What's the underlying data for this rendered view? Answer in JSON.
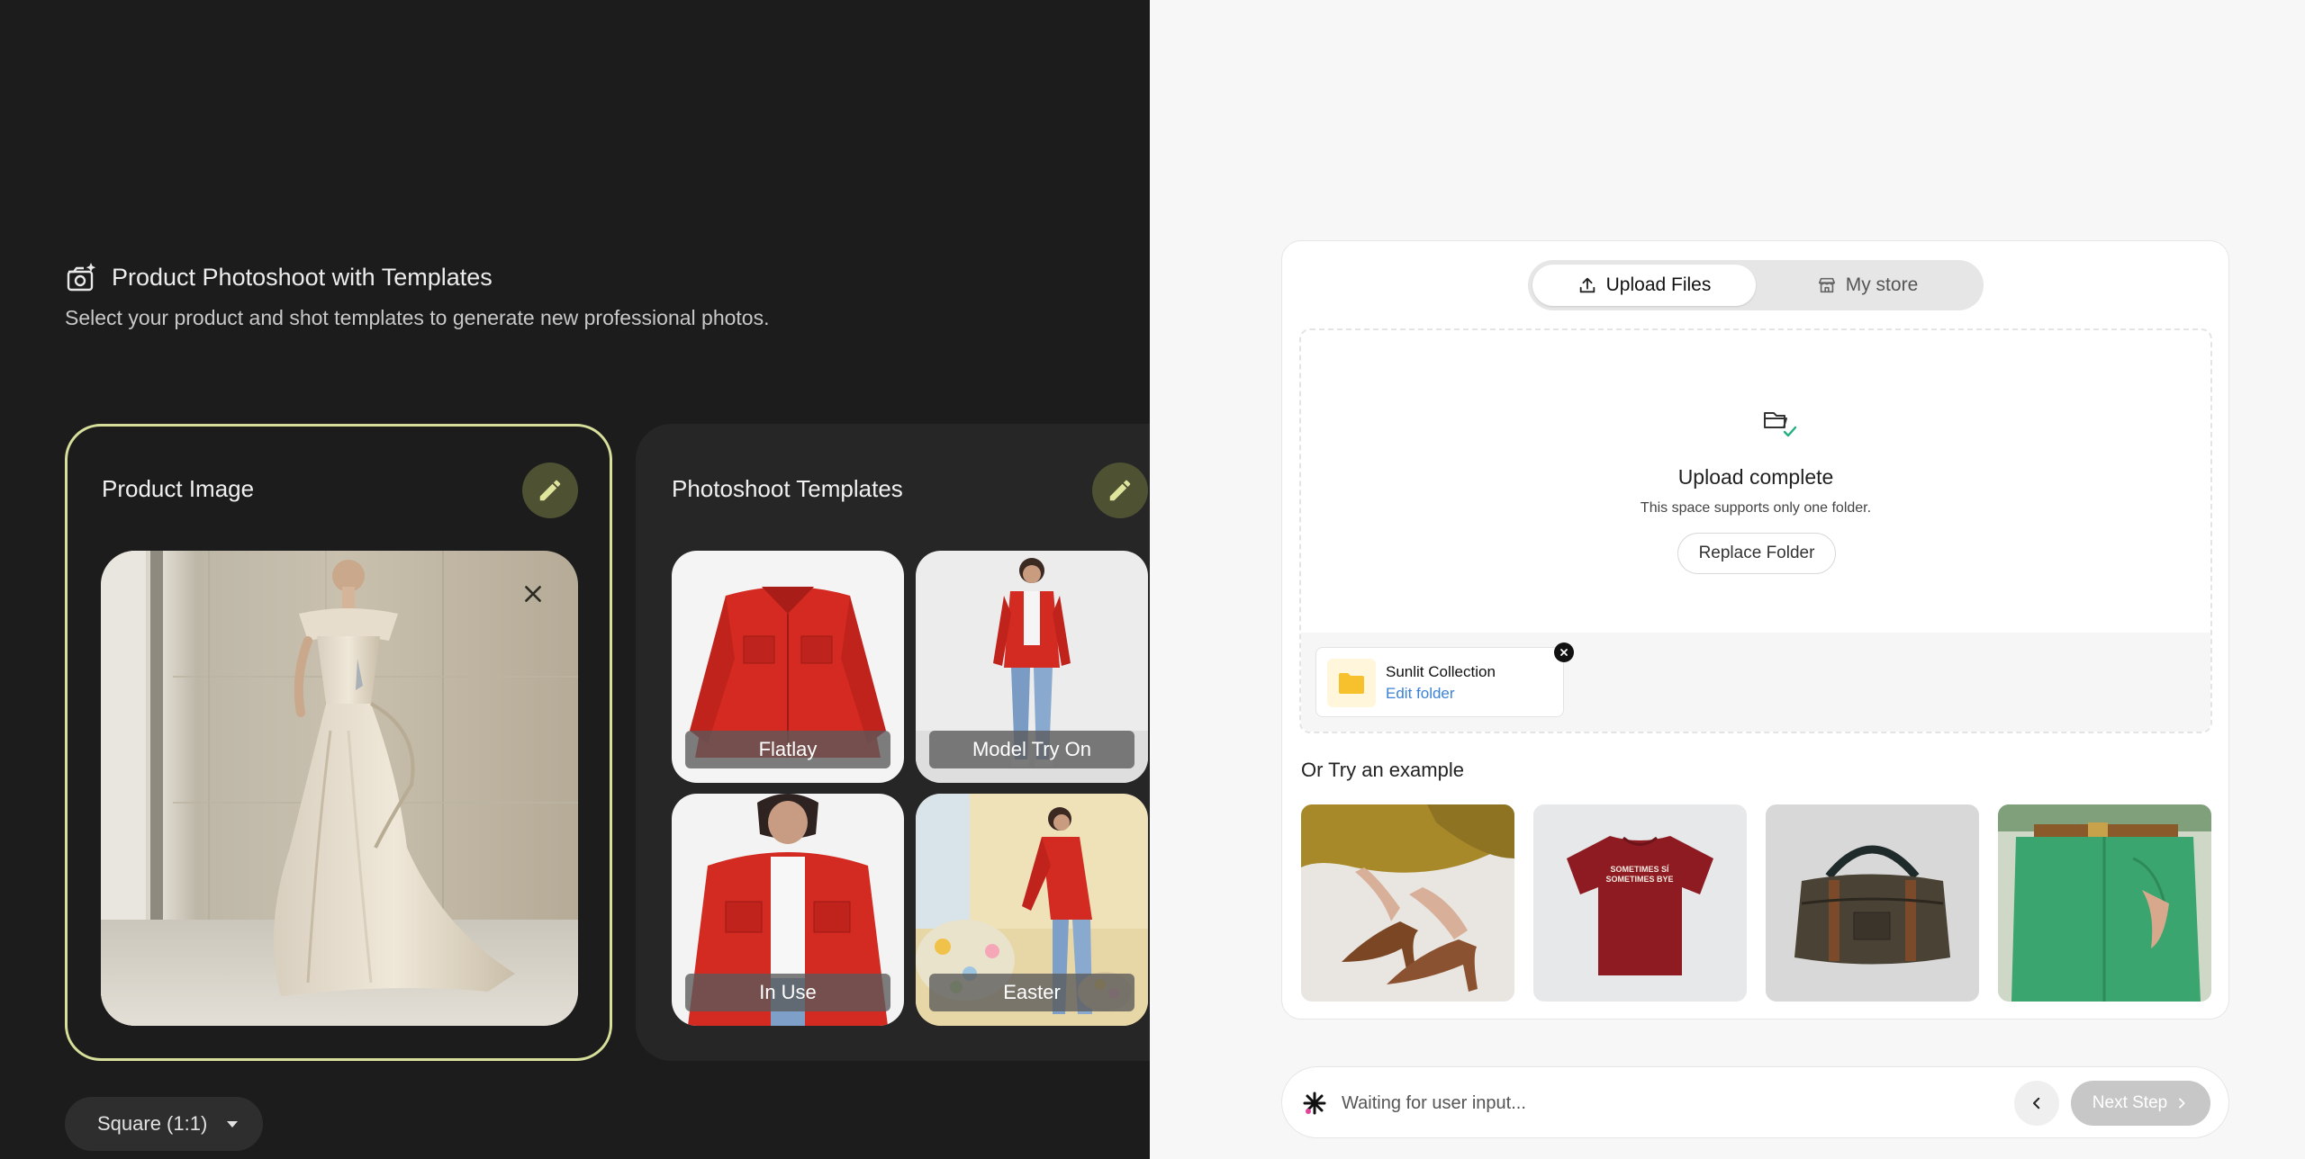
{
  "left_panel": {
    "title": "Product Photoshoot with Templates",
    "subtitle": "Select your product and shot templates to generate new professional photos.",
    "product_card": {
      "title": "Product Image",
      "edit_icon": "pencil-icon",
      "remove_icon": "close-icon"
    },
    "templates_card": {
      "title": "Photoshoot Templates",
      "edit_icon": "pencil-icon",
      "items": [
        {
          "label": "Flatlay"
        },
        {
          "label": "Model Try On"
        },
        {
          "label": "In Use"
        },
        {
          "label": "Easter"
        }
      ]
    },
    "aspect_select": {
      "label": "Square (1:1)"
    }
  },
  "right_panel": {
    "tabs": [
      {
        "label": "Upload Files",
        "icon": "upload-icon",
        "active": true
      },
      {
        "label": "My store",
        "icon": "store-icon",
        "active": false
      }
    ],
    "dropzone": {
      "title": "Upload complete",
      "note": "This space supports only one folder.",
      "replace_label": "Replace Folder",
      "folder": {
        "name": "Sunlit Collection",
        "edit_label": "Edit folder"
      }
    },
    "examples_title": "Or Try an example",
    "examples": [
      {
        "name": "brown-heels"
      },
      {
        "name": "red-tshirt",
        "print": "SOMETIMES SÍ SOMETIMES BYE"
      },
      {
        "name": "duffel-bag"
      },
      {
        "name": "green-jeans"
      }
    ]
  },
  "status_bar": {
    "text": "Waiting for user input...",
    "next_label": "Next Step"
  },
  "colors": {
    "dark_bg": "#1c1c1c",
    "accent_border": "#d8df9a",
    "edit_button": "#4f5133",
    "link_blue": "#3b82d6",
    "red_jacket": "#d42a22"
  }
}
